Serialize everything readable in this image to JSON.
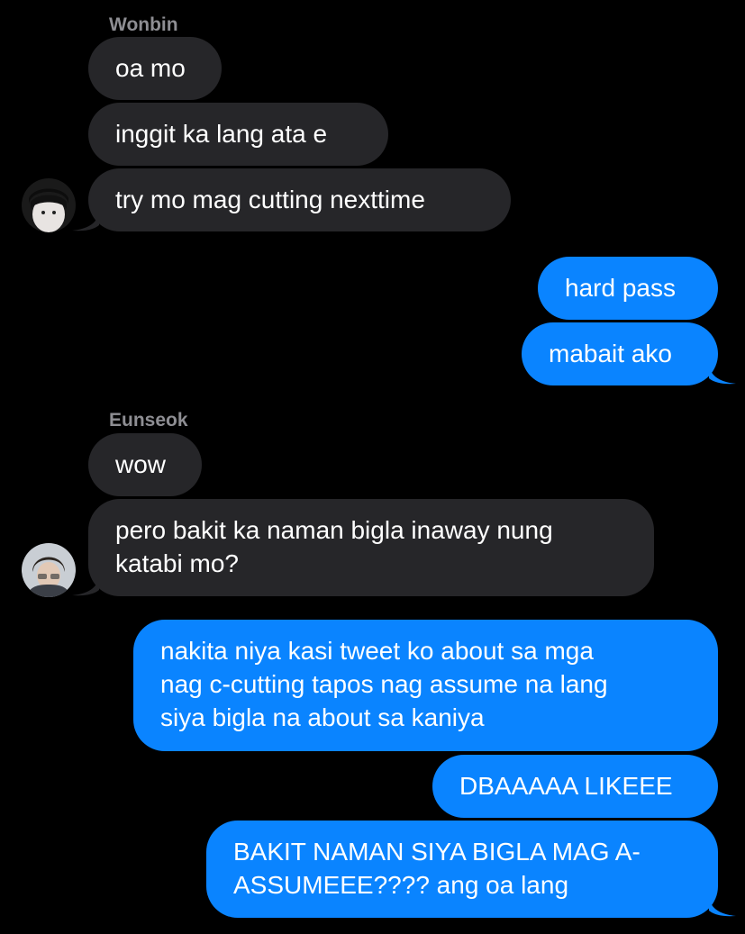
{
  "groups": [
    {
      "sender": "Wonbin",
      "messages": [
        "oa mo",
        "inggit ka lang ata e",
        "try mo mag cutting nexttime"
      ]
    },
    {
      "messages": [
        "hard pass",
        "mabait ako"
      ]
    },
    {
      "sender": "Eunseok",
      "messages": [
        "wow",
        "pero bakit ka naman bigla inaway nung\nkatabi mo?"
      ]
    },
    {
      "messages": [
        "nakita niya kasi tweet ko about sa mga\nnag c-cutting tapos nag assume na lang\nsiya bigla na about sa kaniya",
        "DBAAAAA LIKEEE",
        "BAKIT NAMAN SIYA BIGLA MAG A-\nASSUMEEE???? ang oa lang"
      ]
    }
  ],
  "colors": {
    "background": "#000000",
    "incoming_bubble": "#262629",
    "outgoing_bubble": "#0a84ff",
    "sender_name": "#8e8e93",
    "text": "#ffffff"
  }
}
